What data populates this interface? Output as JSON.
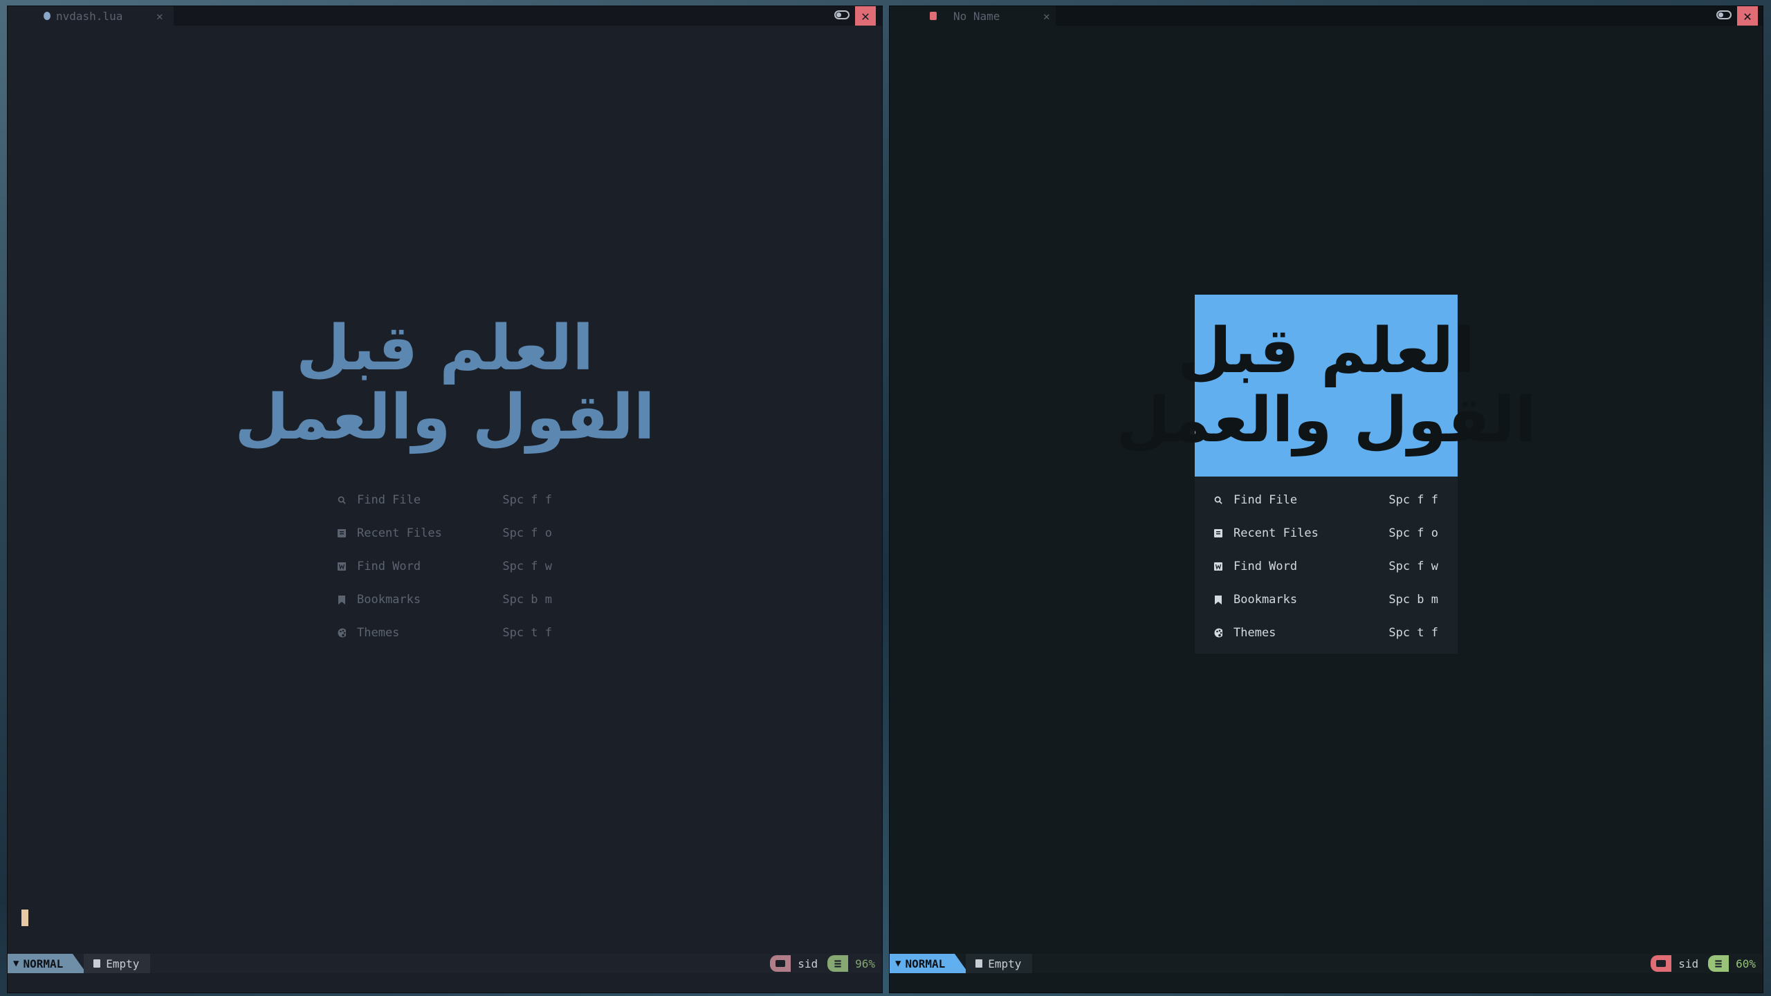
{
  "logo_text": [
    "العلم قبل",
    "القول والعمل"
  ],
  "left": {
    "tab": {
      "label": "nvdash.lua",
      "close": "✕",
      "icon_color": "#8aa7c7"
    },
    "close_glyph": "✕",
    "menu": [
      {
        "icon": "search-icon",
        "label": "Find File",
        "keys": "Spc f f"
      },
      {
        "icon": "file-icon",
        "label": "Recent Files",
        "keys": "Spc f o"
      },
      {
        "icon": "word-icon",
        "label": "Find Word",
        "keys": "Spc f w"
      },
      {
        "icon": "bookmark-icon",
        "label": "Bookmarks",
        "keys": "Spc b m"
      },
      {
        "icon": "palette-icon",
        "label": "Themes",
        "keys": "Spc t f"
      }
    ],
    "status": {
      "mode": "NORMAL",
      "file": "Empty",
      "cwd": "sid",
      "percent": "96%"
    }
  },
  "right": {
    "tab": {
      "label": "No Name",
      "close": "✕",
      "icon_color": "#e06c75"
    },
    "close_glyph": "✕",
    "menu": [
      {
        "icon": "search-icon",
        "label": "Find File",
        "keys": "Spc f f"
      },
      {
        "icon": "file-icon",
        "label": "Recent Files",
        "keys": "Spc f o"
      },
      {
        "icon": "word-icon",
        "label": "Find Word",
        "keys": "Spc f w"
      },
      {
        "icon": "bookmark-icon",
        "label": "Bookmarks",
        "keys": "Spc b m"
      },
      {
        "icon": "palette-icon",
        "label": "Themes",
        "keys": "Spc t f"
      }
    ],
    "status": {
      "mode": "NORMAL",
      "file": "Empty",
      "cwd": "sid",
      "percent": "60%"
    }
  },
  "colors": {
    "accent": "#61afef",
    "close_red": "#e06c75",
    "green": "#98c379"
  }
}
